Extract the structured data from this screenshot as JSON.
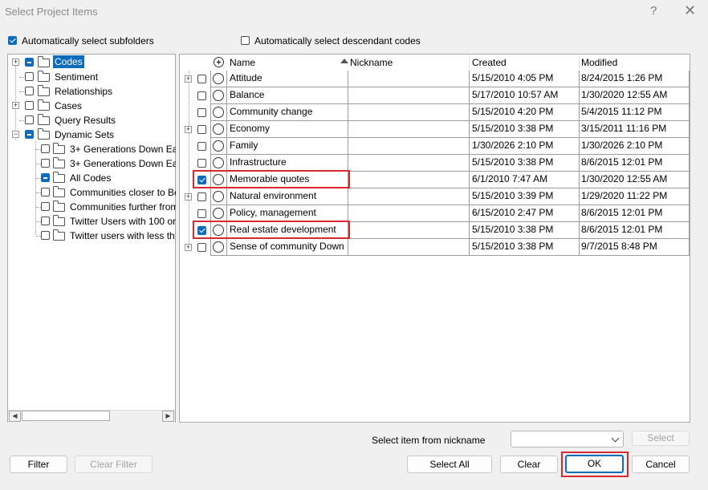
{
  "window": {
    "title": "Select Project Items",
    "help": "?",
    "close": "✕"
  },
  "options": {
    "auto_subfolders": {
      "label": "Automatically select subfolders",
      "checked": true
    },
    "auto_descendants": {
      "label": "Automatically select descendant codes",
      "checked": false
    }
  },
  "tree": {
    "items": [
      {
        "label": "Codes"
      },
      {
        "label": "Sentiment"
      },
      {
        "label": "Relationships"
      },
      {
        "label": "Cases"
      },
      {
        "label": "Query Results"
      },
      {
        "label": "Dynamic Sets"
      },
      {
        "label": "3+ Generations Down Ea"
      },
      {
        "label": "3+ Generations Down Ea"
      },
      {
        "label": "All Codes"
      },
      {
        "label": "Communities closer to Be"
      },
      {
        "label": "Communities further from"
      },
      {
        "label": "Twitter Users with 100 or"
      },
      {
        "label": "Twitter users with less th"
      }
    ]
  },
  "grid": {
    "headers": {
      "name": "Name",
      "nickname": "Nickname",
      "created": "Created",
      "modified": "Modified"
    },
    "rows": [
      {
        "name": "Attitude",
        "nickname": "",
        "created": "5/15/2010 4:05 PM",
        "modified": "8/24/2015 1:26 PM"
      },
      {
        "name": "Balance",
        "nickname": "",
        "created": "5/17/2010 10:57 AM",
        "modified": "1/30/2020 12:55 AM"
      },
      {
        "name": "Community change",
        "nickname": "",
        "created": "5/15/2010 4:20 PM",
        "modified": "5/4/2015 11:12 PM"
      },
      {
        "name": "Economy",
        "nickname": "",
        "created": "5/15/2010 3:38 PM",
        "modified": "3/15/2011 11:16 PM"
      },
      {
        "name": "Family",
        "nickname": "",
        "created": "1/30/2026 2:10 PM",
        "modified": "1/30/2026 2:10 PM"
      },
      {
        "name": "Infrastructure",
        "nickname": "",
        "created": "5/15/2010 3:38 PM",
        "modified": "8/6/2015 12:01 PM"
      },
      {
        "name": "Memorable quotes",
        "nickname": "",
        "created": "6/1/2010 7:47 AM",
        "modified": "1/30/2020 12:55 AM"
      },
      {
        "name": "Natural environment",
        "nickname": "",
        "created": "5/15/2010 3:39 PM",
        "modified": "1/29/2020 11:22 PM"
      },
      {
        "name": "Policy, management",
        "nickname": "",
        "created": "6/15/2010 2:47 PM",
        "modified": "8/6/2015 12:01 PM"
      },
      {
        "name": "Real estate development",
        "nickname": "",
        "created": "5/15/2010 3:38 PM",
        "modified": "8/6/2015 12:01 PM"
      },
      {
        "name": "Sense of community Down",
        "nickname": "",
        "created": "5/15/2010 3:38 PM",
        "modified": "9/7/2015 8:48 PM"
      }
    ]
  },
  "nickname": {
    "label": "Select item from nickname",
    "value": "",
    "select_label": "Select"
  },
  "buttons": {
    "filter": "Filter",
    "clear_filter": "Clear Filter",
    "select_all": "Select All",
    "clear": "Clear",
    "ok": "OK",
    "cancel": "Cancel"
  },
  "colors": {
    "accent": "#0f6cbd",
    "highlight": "#d9282f"
  }
}
